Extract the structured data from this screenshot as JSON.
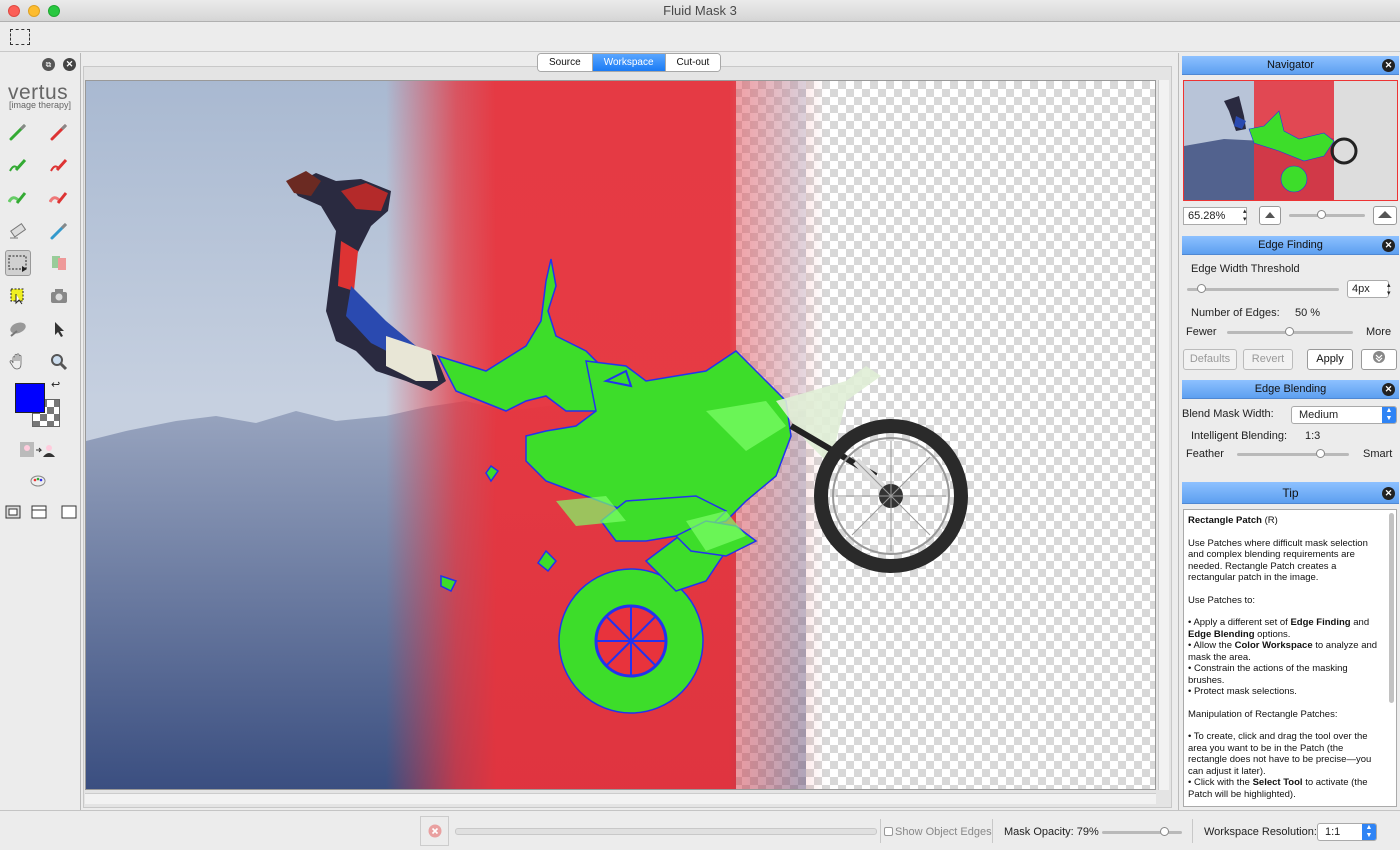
{
  "window": {
    "title": "Fluid Mask 3"
  },
  "logo": {
    "name": "vertus",
    "tagline": "[image therapy]"
  },
  "view_tabs": [
    {
      "label": "Source",
      "selected": false
    },
    {
      "label": "Workspace",
      "selected": true
    },
    {
      "label": "Cut-out",
      "selected": false
    }
  ],
  "left_tools": [
    "green-brush-icon",
    "red-brush-icon",
    "green-edge-brush-icon",
    "red-edge-brush-icon",
    "green-gradient-brush-icon",
    "red-gradient-brush-icon",
    "eraser-icon",
    "blue-brush-icon",
    "rectangle-patch-icon",
    "patch-brush-icon",
    "select-patch-icon",
    "camera-icon",
    "smudge-icon",
    "pointer-icon",
    "hand-icon",
    "zoom-icon"
  ],
  "colors": {
    "foreground": "#0000ff",
    "accent": "#1a7bf5",
    "keep_mask": "#33dd22",
    "delete_mask": "#e8333c",
    "edge_outline": "#2233ee"
  },
  "navigator": {
    "title": "Navigator",
    "zoom": "65.28%"
  },
  "edge_finding": {
    "title": "Edge Finding",
    "threshold_label": "Edge Width Threshold",
    "threshold_value": "4px",
    "threshold_level": 0.1,
    "edges_label": "Number of Edges:",
    "edges_value": "50 %",
    "edges_level": 0.5,
    "fewer": "Fewer",
    "more": "More",
    "defaults": "Defaults",
    "revert": "Revert",
    "apply": "Apply"
  },
  "edge_blending": {
    "title": "Edge Blending",
    "blend_width_label": "Blend Mask Width:",
    "blend_width_value": "Medium",
    "intelligent_label": "Intelligent Blending:",
    "intelligent_value": "1:3",
    "intelligent_level": 0.75,
    "feather": "Feather",
    "smart": "Smart"
  },
  "tip": {
    "title": "Tip",
    "heading": "Rectangle Patch",
    "shortcut": "(R)",
    "intro": "Use Patches where difficult mask selection and complex blending requirements are needed. Rectangle Patch creates a rectangular patch in the image.",
    "use_heading": "Use Patches to:",
    "b1a": "• Apply a different set of ",
    "b1b": "Edge Finding",
    "b1c": " and ",
    "b1d": "Edge Blending",
    "b1e": " options.",
    "b2a": "• Allow the ",
    "b2b": "Color Workspace",
    "b2c": " to analyze and mask the area.",
    "b3": "• Constrain the actions of the masking brushes.",
    "b4": "• Protect mask selections.",
    "manip_heading": "Manipulation of Rectangle Patches:",
    "m1": "• To create, click and drag the tool over the area you want to be in the Patch (the rectangle does not have to be precise—you can adjust it later).",
    "m2a": "• Click with the ",
    "m2b": "Select Tool",
    "m2c": " to activate (the Patch will be highlighted)."
  },
  "status": {
    "show_edges": "Show Object Edges",
    "mask_opacity": "Mask Opacity: 79%",
    "mask_opacity_level": 0.79,
    "workspace_res_label": "Workspace Resolution:",
    "workspace_res_value": "1:1"
  }
}
